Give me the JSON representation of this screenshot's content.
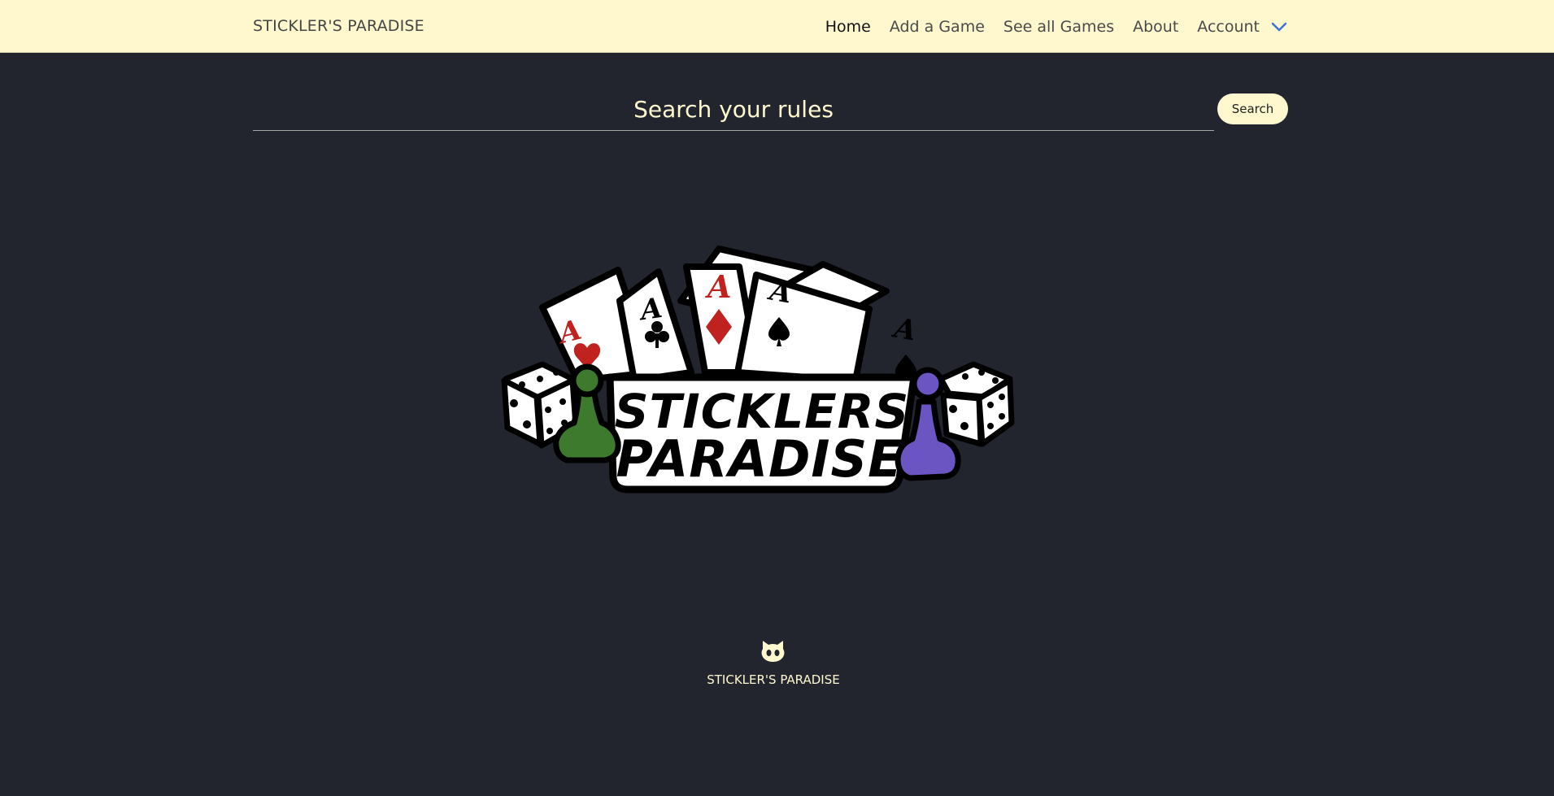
{
  "navbar": {
    "brand": "STICKLER'S PARADISE",
    "links": [
      {
        "label": "Home",
        "active": true
      },
      {
        "label": "Add a Game"
      },
      {
        "label": "See all Games"
      },
      {
        "label": "About"
      },
      {
        "label": "Account",
        "icon": "chevron-down-icon"
      }
    ]
  },
  "search": {
    "placeholder": "Search your rules",
    "button_label": "Search"
  },
  "logo": {
    "line1": "STICKLERS",
    "line2": "PARADISE",
    "card_rank": "A"
  },
  "footer": {
    "icon": "github-icon",
    "text": "STICKLER'S PARADISE"
  },
  "colors": {
    "background": "#22252e",
    "navbar": "#fff8cf",
    "accent": "#fff8cf",
    "chevron": "#3c6fd8",
    "card_red": "#c0231f",
    "pawn_green": "#3d7a2e",
    "pawn_purple": "#6a55c2"
  }
}
